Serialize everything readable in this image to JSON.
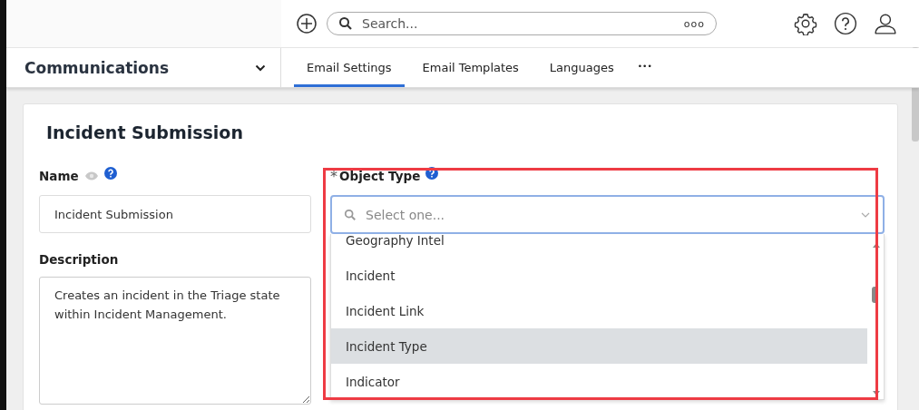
{
  "topbar": {
    "search": {
      "placeholder": "Search..."
    },
    "search_more": "ooo"
  },
  "nav": {
    "title": "Communications",
    "tabs": [
      {
        "label": "Email Settings",
        "selected": true
      },
      {
        "label": "Email Templates",
        "selected": false
      },
      {
        "label": "Languages",
        "selected": false
      }
    ],
    "more": "•••"
  },
  "card": {
    "title": "Incident Submission",
    "name": {
      "label": "Name",
      "value": "Incident Submission"
    },
    "description": {
      "label": "Description",
      "value": "Creates an incident in the Triage state within Incident Management."
    },
    "object_type": {
      "required_mark": "*",
      "label": "Object Type",
      "placeholder": "Select one...",
      "options": [
        {
          "label": "Geography Intel",
          "selected": false
        },
        {
          "label": "Incident",
          "selected": false
        },
        {
          "label": "Incident Link",
          "selected": false
        },
        {
          "label": "Incident Type",
          "selected": true
        },
        {
          "label": "Indicator",
          "selected": false
        }
      ]
    }
  }
}
